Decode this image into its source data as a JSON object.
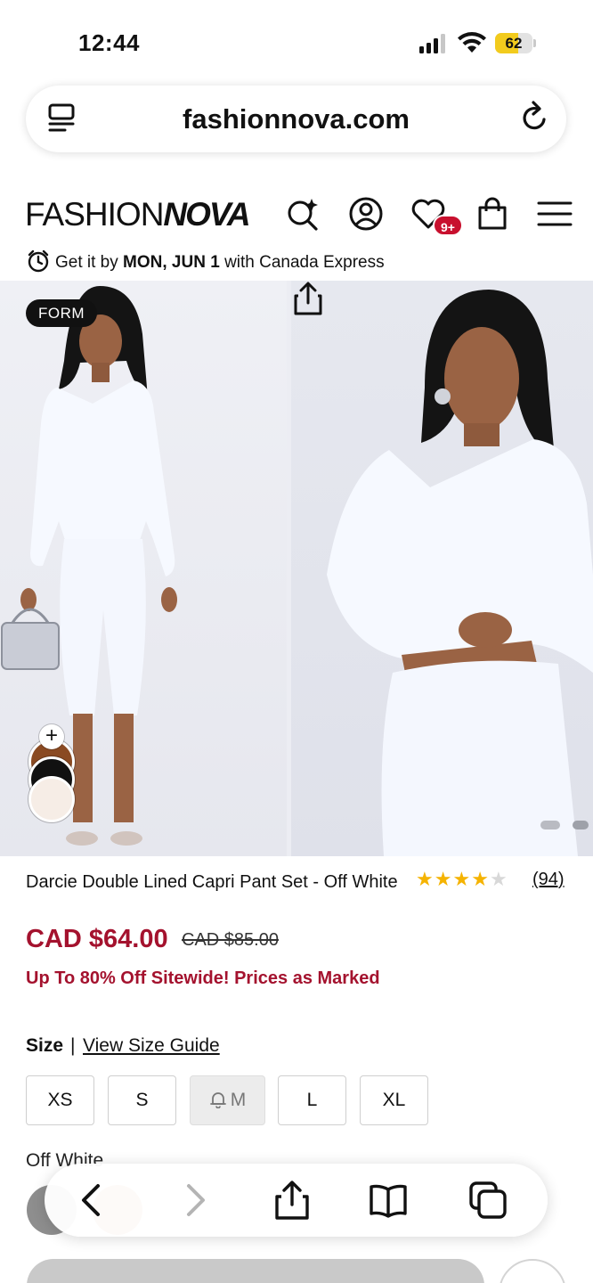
{
  "status_bar": {
    "time": "12:44",
    "battery_level": "62",
    "battery_fraction": 0.62,
    "battery_color": "#f2cb1d"
  },
  "browser": {
    "url": "fashionnova.com",
    "left_icon": "reader-icon",
    "right_icon": "reload-icon"
  },
  "header": {
    "logo_light": "FASHION",
    "logo_bold": "NOVA",
    "icons": [
      "ai-search-icon",
      "account-icon",
      "wishlist-icon",
      "bag-icon",
      "menu-icon"
    ],
    "wishlist_badge": "9+",
    "badge_color": "#c8102e"
  },
  "delivery": {
    "prefix": "Get it by",
    "date": "MON, JUN 1",
    "suffix": "with Canada Express"
  },
  "gallery": {
    "badge": "FORM",
    "swatch_add": "+",
    "swatch_colors": [
      "#8a4a22",
      "#111111",
      "#f6ede6"
    ],
    "pager_dot_count": 4,
    "pager_active_index": 1,
    "share_icon": "share-icon"
  },
  "product": {
    "title": "Darcie Double Lined Capri Pant Set - Off White",
    "rating": 4,
    "rating_max": 5,
    "review_count": "(94)",
    "price": "CAD $64.00",
    "compare_price": "CAD $85.00",
    "price_color": "#a4122e",
    "promo": "Up To 80% Off Sitewide! Prices as Marked"
  },
  "size": {
    "label": "Size",
    "separator": "|",
    "guide_link": "View Size Guide",
    "options": [
      {
        "label": "XS",
        "available": true
      },
      {
        "label": "S",
        "available": true
      },
      {
        "label": "M",
        "available": false
      },
      {
        "label": "L",
        "available": true
      },
      {
        "label": "XL",
        "available": true
      }
    ]
  },
  "color": {
    "label": "Off White"
  },
  "toolbar": {
    "icons": [
      "back-icon",
      "forward-icon",
      "share-icon",
      "bookmarks-icon",
      "tabs-icon"
    ]
  }
}
